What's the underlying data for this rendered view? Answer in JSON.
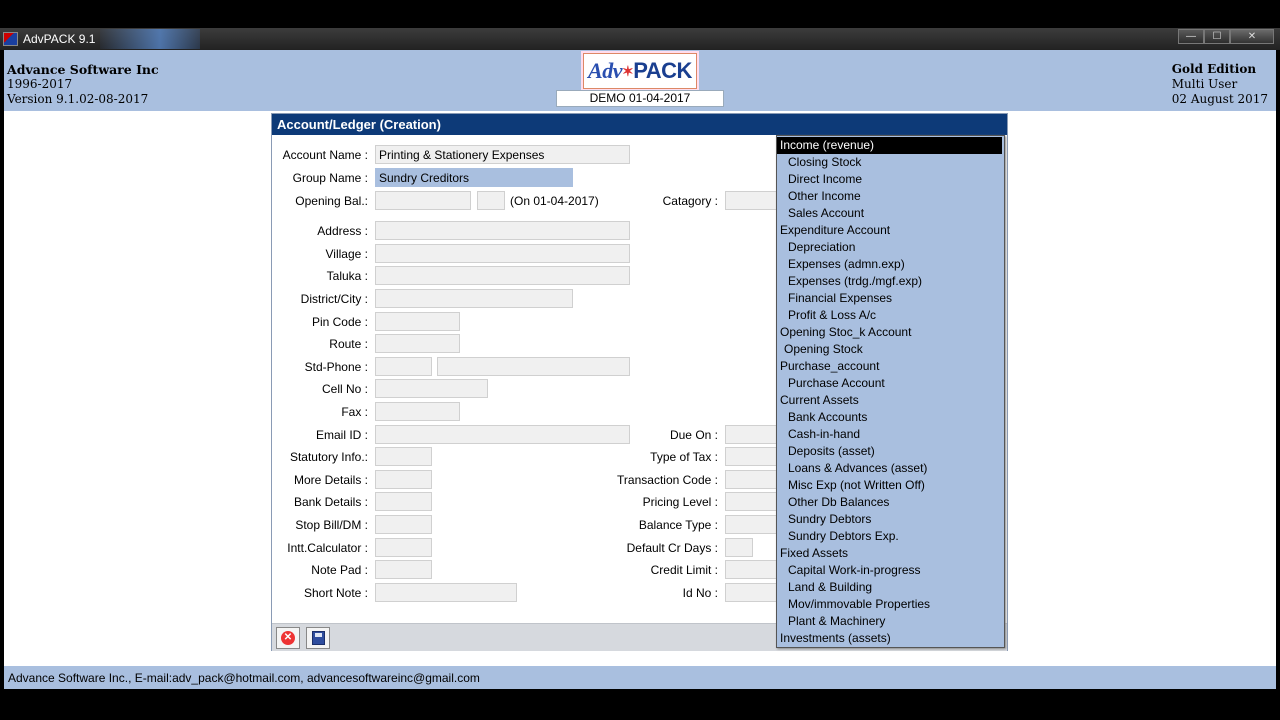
{
  "window": {
    "title": "AdvPACK 9.1",
    "buttons": {
      "minimize": "—",
      "maximize": "☐",
      "close": "✕"
    }
  },
  "header": {
    "company": "Advance Software Inc",
    "years": "1996-2017",
    "version": "Version 9.1.02-08-2017",
    "logo": {
      "part1": "Adv",
      "star": "✶",
      "part2": "PACK"
    },
    "demo_label": "DEMO 01-04-2017",
    "edition": "Gold Edition",
    "user_mode": "Multi User",
    "date": "02 August 2017"
  },
  "dialog": {
    "title": "Account/Ledger (Creation)",
    "labels": {
      "account_name": "Account Name :",
      "group_name": "Group Name :",
      "opening_bal": "Opening Bal.:",
      "opening_on": "(On 01-04-2017)",
      "category": "Catagory :",
      "address": "Address :",
      "village": "Village :",
      "taluka": "Taluka :",
      "district": "District/City :",
      "pin": "Pin Code :",
      "route": "Route :",
      "std_phone": "Std-Phone :",
      "cell": "Cell No :",
      "fax": "Fax :",
      "email": "Email ID :",
      "statutory": "Statutory Info.:",
      "more_details": "More Details :",
      "bank_details": "Bank Details :",
      "stop_bill": "Stop Bill/DM :",
      "intt_calc": "Intt.Calculator :",
      "note_pad": "Note Pad :",
      "short_note": "Short Note :",
      "due_on": "Due On :",
      "type_of_tax": "Type of Tax :",
      "transaction_code": "Transaction Code :",
      "pricing_level": "Pricing Level :",
      "balance_type": "Balance Type :",
      "default_cr_days": "Default Cr Days :",
      "credit_limit": "Credit Limit :",
      "id_no": "Id No :"
    },
    "values": {
      "account_name": "Printing & Stationery Expenses",
      "group_name": "Sundry Creditors"
    }
  },
  "dropdown": {
    "items": [
      {
        "label": "Income (revenue)",
        "level": "grp",
        "selected": true
      },
      {
        "label": "Closing Stock",
        "level": "sub"
      },
      {
        "label": "Direct Income",
        "level": "sub"
      },
      {
        "label": "Other Income",
        "level": "sub"
      },
      {
        "label": "Sales Account",
        "level": "sub"
      },
      {
        "label": "Expenditure Account",
        "level": "grp"
      },
      {
        "label": "Depreciation",
        "level": "sub"
      },
      {
        "label": "Expenses (admn.exp)",
        "level": "sub"
      },
      {
        "label": "Expenses (trdg./mgf.exp)",
        "level": "sub"
      },
      {
        "label": "Financial Expenses",
        "level": "sub"
      },
      {
        "label": "Profit & Loss A/c",
        "level": "sub"
      },
      {
        "label": "Opening Stoc_k Account",
        "level": "grp"
      },
      {
        "label": "Opening Stock",
        "level": "sub2"
      },
      {
        "label": "Purchase_account",
        "level": "grp"
      },
      {
        "label": "Purchase Account",
        "level": "sub"
      },
      {
        "label": "Current Assets",
        "level": "grp"
      },
      {
        "label": "Bank Accounts",
        "level": "sub"
      },
      {
        "label": "Cash-in-hand",
        "level": "sub"
      },
      {
        "label": "Deposits (asset)",
        "level": "sub"
      },
      {
        "label": "Loans & Advances (asset)",
        "level": "sub"
      },
      {
        "label": "Misc Exp (not Written Off)",
        "level": "sub"
      },
      {
        "label": "Other Db Balances",
        "level": "sub"
      },
      {
        "label": "Sundry Debtors",
        "level": "sub"
      },
      {
        "label": "Sundry Debtors Exp.",
        "level": "sub"
      },
      {
        "label": "Fixed Assets",
        "level": "grp"
      },
      {
        "label": "Capital Work-in-progress",
        "level": "sub"
      },
      {
        "label": "Land & Building",
        "level": "sub"
      },
      {
        "label": "Mov/immovable Properties",
        "level": "sub"
      },
      {
        "label": "Plant & Machinery",
        "level": "sub"
      },
      {
        "label": "Investments (assets)",
        "level": "grp"
      }
    ]
  },
  "statusbar": {
    "text": "Advance Software Inc., E-mail:adv_pack@hotmail.com, advancesoftwareinc@gmail.com"
  }
}
